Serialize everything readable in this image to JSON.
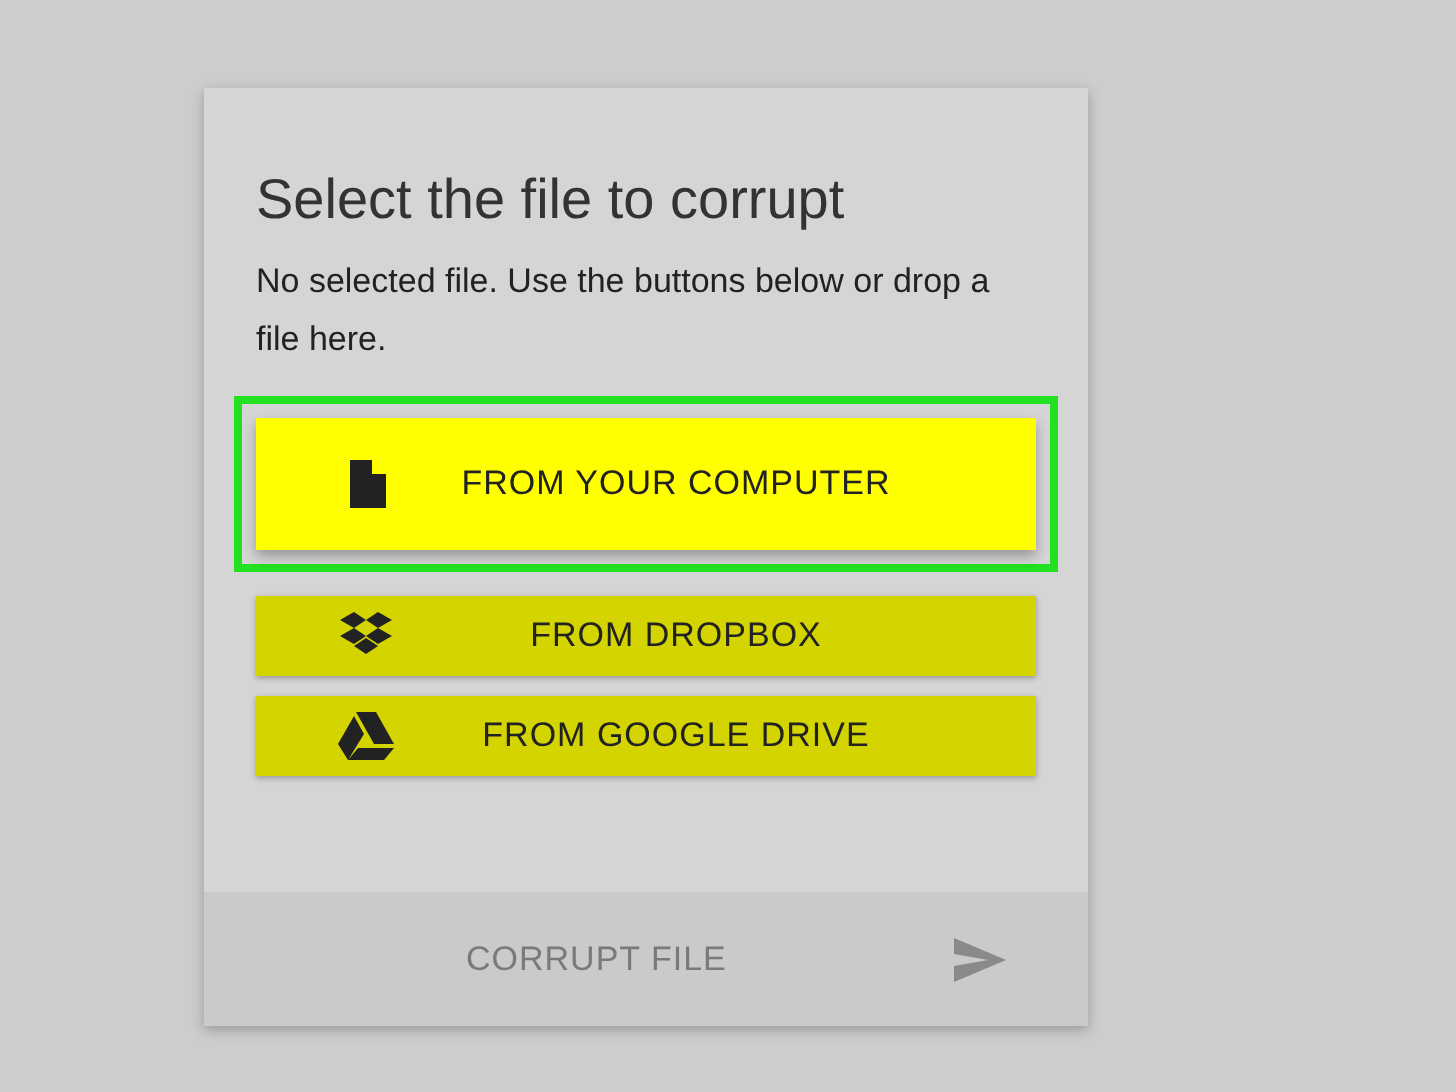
{
  "card": {
    "title": "Select the file to corrupt",
    "description": "No selected file. Use the buttons below or drop a file here.",
    "sources": [
      {
        "label": "FROM YOUR COMPUTER",
        "kind": "file",
        "highlighted": true
      },
      {
        "label": "FROM DROPBOX",
        "kind": "dropbox",
        "highlighted": false
      },
      {
        "label": "FROM GOOGLE DRIVE",
        "kind": "drive",
        "highlighted": false
      }
    ],
    "submit": {
      "label": "CORRUPT FILE",
      "disabled": true
    }
  }
}
